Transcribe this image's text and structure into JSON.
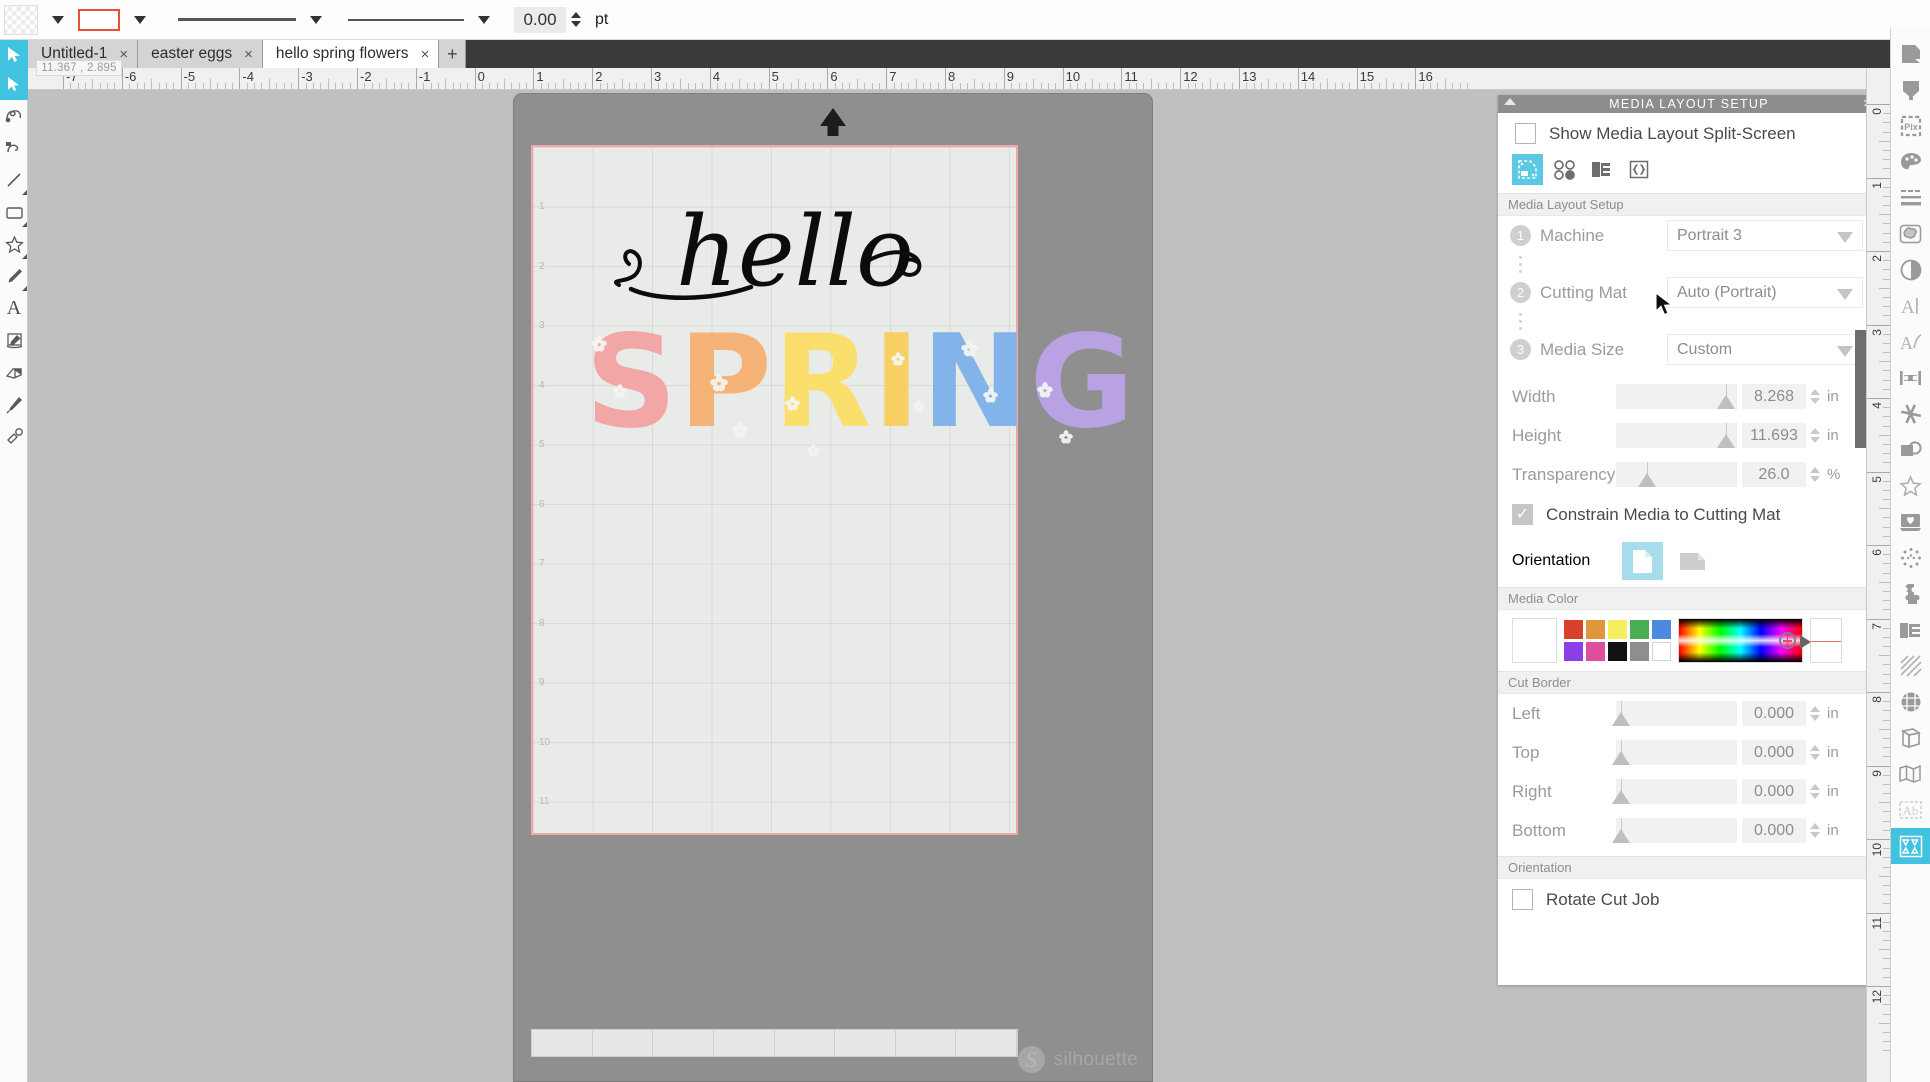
{
  "topbar": {
    "fill_icon": "checker-swatch",
    "stroke_icon": "stroke-swatch",
    "line_style_icon": "line-solid",
    "line_weight_icon": "line-solid-2",
    "thickness_value": "0.00",
    "thickness_unit": "pt"
  },
  "tabs": {
    "items": [
      {
        "label": "Untitled-1",
        "active": false,
        "close": "×"
      },
      {
        "label": "easter eggs",
        "active": false,
        "close": "×"
      },
      {
        "label": "hello spring flowers",
        "active": true,
        "close": "×"
      }
    ],
    "add_label": "+"
  },
  "status": {
    "coordinates": "11.367 , 2.895"
  },
  "rulers": {
    "horizontal_labels": [
      "-7",
      "-6",
      "-5",
      "-4",
      "-3",
      "-2",
      "-1",
      "0",
      "1",
      "2",
      "3",
      "4",
      "5",
      "6",
      "7",
      "8",
      "9",
      "10",
      "11",
      "12",
      "13",
      "14",
      "15",
      "16"
    ],
    "vertical_labels": [
      "0",
      "1",
      "2",
      "3",
      "4",
      "5",
      "6",
      "7",
      "8",
      "9",
      "10",
      "11",
      "12"
    ],
    "mat_row_labels": [
      "1",
      "2",
      "3",
      "4",
      "5",
      "6",
      "7",
      "8",
      "9",
      "10",
      "11"
    ]
  },
  "left_tools": [
    {
      "name": "select-arrow-tool",
      "selected": true
    },
    {
      "name": "draw-freehand-tool",
      "selected": false
    },
    {
      "name": "draw-curve-tool",
      "selected": false
    },
    {
      "name": "line-tool",
      "selected": false
    },
    {
      "name": "rectangle-tool",
      "selected": false
    },
    {
      "name": "polygon-star-tool",
      "selected": false
    },
    {
      "name": "pencil-tool",
      "selected": false
    },
    {
      "name": "text-tool",
      "selected": false
    },
    {
      "name": "notes-tool",
      "selected": false
    },
    {
      "name": "eraser-tool",
      "selected": false
    },
    {
      "name": "knife-tool",
      "selected": false
    },
    {
      "name": "eyedropper-tool",
      "selected": false
    }
  ],
  "right_tools": [
    {
      "name": "page-setup-icon",
      "selected": false
    },
    {
      "name": "cut-settings-icon",
      "selected": false
    },
    {
      "name": "pixscan-icon",
      "selected": false
    },
    {
      "name": "fill-color-icon",
      "selected": false
    },
    {
      "name": "line-style-icon",
      "selected": false
    },
    {
      "name": "sketch-pattern-icon",
      "selected": false
    },
    {
      "name": "transparency-icon",
      "selected": false
    },
    {
      "name": "text-style-icon",
      "selected": false
    },
    {
      "name": "text-on-path-icon",
      "selected": false
    },
    {
      "name": "align-icon",
      "selected": false
    },
    {
      "name": "modify-icon",
      "selected": false
    },
    {
      "name": "offset-icon",
      "selected": false
    },
    {
      "name": "trace-star-icon",
      "selected": false
    },
    {
      "name": "library-icon",
      "selected": false
    },
    {
      "name": "sparkle-icon",
      "selected": false
    },
    {
      "name": "puzzle-icon",
      "selected": false
    },
    {
      "name": "nesting-icon",
      "selected": false
    },
    {
      "name": "hatch-fill-icon",
      "selected": false
    },
    {
      "name": "grid-sphere-icon",
      "selected": false
    },
    {
      "name": "warp-icon",
      "selected": false
    },
    {
      "name": "perspective-icon",
      "selected": false
    },
    {
      "name": "knockout-text-icon",
      "selected": false
    },
    {
      "name": "media-layout-setup-icon",
      "selected": true
    }
  ],
  "panel": {
    "title": "MEDIA LAYOUT SETUP",
    "close_label": "×",
    "split_screen": {
      "label": "Show Media Layout Split-Screen",
      "checked": false
    },
    "tabs": [
      {
        "name": "media-layout-tab",
        "selected": true
      },
      {
        "name": "registration-marks-tab",
        "selected": false
      },
      {
        "name": "feed-options-tab",
        "selected": false
      },
      {
        "name": "tiling-tab",
        "selected": false
      }
    ],
    "section_media_layout": {
      "header": "Media Layout Setup",
      "rows": [
        {
          "step": "1",
          "label": "Machine",
          "value": "Portrait 3"
        },
        {
          "step": "2",
          "label": "Cutting Mat",
          "value": "Auto (Portrait)"
        },
        {
          "step": "3",
          "label": "Media Size",
          "value": "Custom"
        }
      ],
      "sliders": [
        {
          "label": "Width",
          "value": "8.268",
          "unit": "in",
          "pos": 92
        },
        {
          "label": "Height",
          "value": "11.693",
          "unit": "in",
          "pos": 92
        },
        {
          "label": "Transparency",
          "value": "26.0",
          "unit": "%",
          "pos": 26
        }
      ],
      "constrain": {
        "label": "Constrain Media to Cutting Mat",
        "checked": true
      },
      "orientation": {
        "label": "Orientation",
        "options": [
          {
            "name": "portrait-orientation-button",
            "selected": true
          },
          {
            "name": "landscape-orientation-button",
            "selected": false
          }
        ]
      }
    },
    "section_media_color": {
      "header": "Media Color",
      "current": "#ffffff",
      "swatches": [
        "#d8402c",
        "#e0963a",
        "#f6ee5e",
        "#4aaf52",
        "#4c8ae0",
        "#8b3fe8",
        "#dd4f9b",
        "#111111",
        "#8e8e8e",
        "#ffffff"
      ]
    },
    "section_cut_border": {
      "header": "Cut Border",
      "rows": [
        {
          "label": "Left",
          "value": "0.000",
          "unit": "in",
          "pos": 4
        },
        {
          "label": "Top",
          "value": "0.000",
          "unit": "in",
          "pos": 4
        },
        {
          "label": "Right",
          "value": "0.000",
          "unit": "in",
          "pos": 4
        },
        {
          "label": "Bottom",
          "value": "0.000",
          "unit": "in",
          "pos": 4
        }
      ]
    },
    "section_orientation": {
      "header": "Orientation",
      "rotate": {
        "label": "Rotate Cut Job",
        "checked": false
      }
    }
  },
  "artwork": {
    "script_word": "hello",
    "word": "SPRING",
    "letters": [
      {
        "char": "S",
        "color": "#f3a6a6"
      },
      {
        "char": "P",
        "color": "#f6b378"
      },
      {
        "char": "R",
        "color": "#fbdf6d"
      },
      {
        "char": "I",
        "color": "#f7cf62"
      },
      {
        "char": "N",
        "color": "#82b4ea"
      },
      {
        "char": "G",
        "color": "#b9a2e4"
      }
    ],
    "watermark": {
      "mark": "S",
      "text": "silhouette"
    }
  }
}
